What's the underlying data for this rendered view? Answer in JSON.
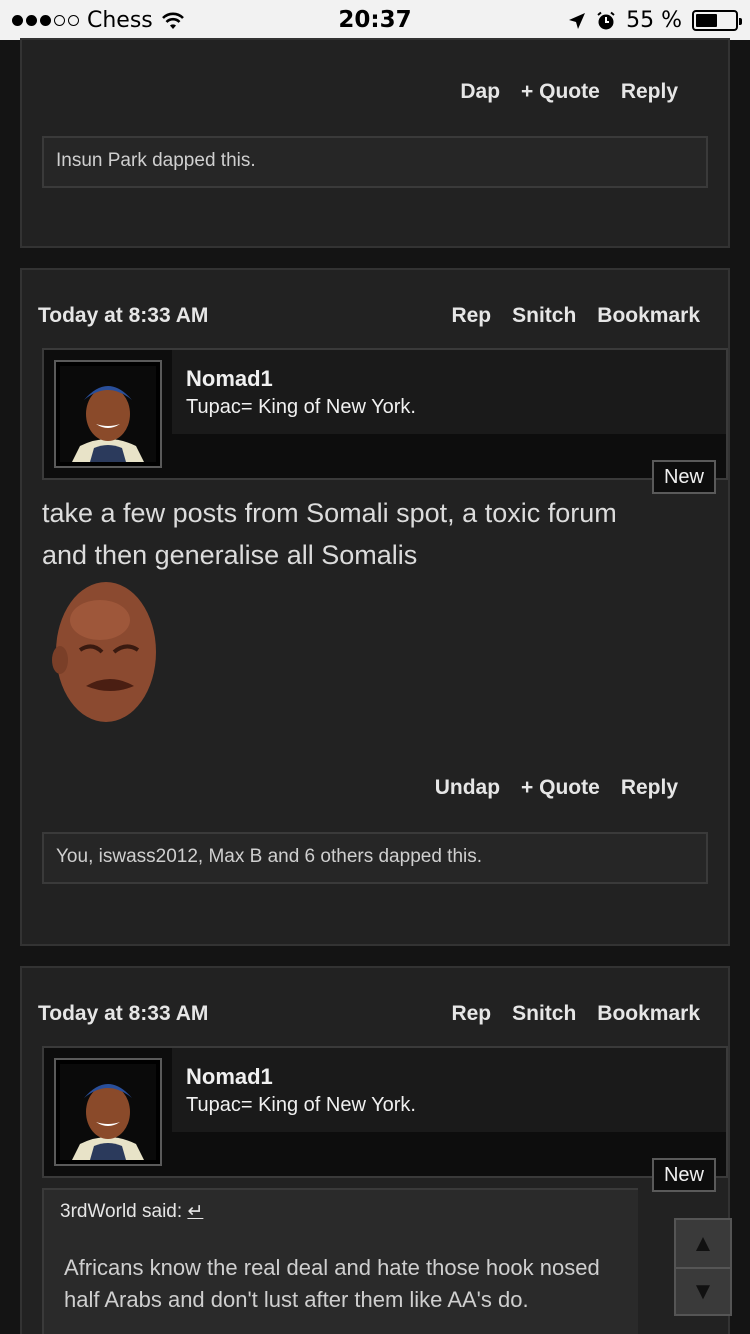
{
  "status_bar": {
    "carrier": "Chess",
    "time": "20:37",
    "battery": "55 %",
    "battery_level": 0.55
  },
  "post1": {
    "actions": [
      "Dap",
      "+ Quote",
      "Reply"
    ],
    "dapped": "Insun Park dapped this."
  },
  "post2": {
    "timestamp": "Today at 8:33 AM",
    "header_actions": [
      "Rep",
      "Snitch",
      "Bookmark"
    ],
    "author": "Nomad1",
    "author_title": "Tupac= King of New York.",
    "badge": "New",
    "body": "take a few posts from Somali spot, a toxic forum and then generalise all Somalis",
    "actions": [
      "Undap",
      "+ Quote",
      "Reply"
    ],
    "dapped": "You, iswass2012, Max B and 6 others dapped this."
  },
  "post3": {
    "timestamp": "Today at 8:33 AM",
    "header_actions": [
      "Rep",
      "Snitch",
      "Bookmark"
    ],
    "author": "Nomad1",
    "author_title": "Tupac= King of New York.",
    "badge": "New",
    "quote_attribution": "3rdWorld said:",
    "quote_icon": "↵",
    "quote_text": "Africans know the real deal and hate those hook nosed half Arabs and don't lust after them like AA's do."
  },
  "scroll": {
    "up": "▲",
    "down": "▼"
  }
}
